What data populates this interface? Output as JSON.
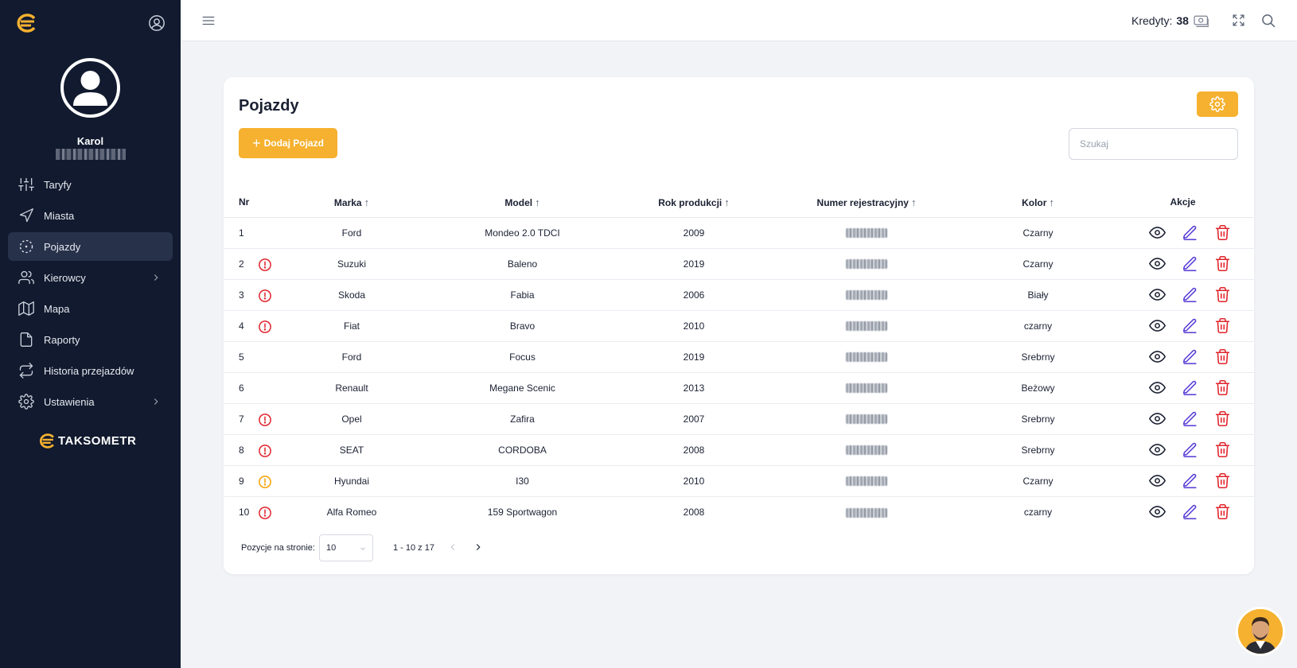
{
  "sidebar": {
    "user_name": "Karol",
    "items": [
      {
        "label": "Taryfy",
        "icon": "sliders-icon"
      },
      {
        "label": "Miasta",
        "icon": "navigation-icon"
      },
      {
        "label": "Pojazdy",
        "icon": "vehicle-target-icon",
        "active": true
      },
      {
        "label": "Kierowcy",
        "icon": "users-icon",
        "has_submenu": true
      },
      {
        "label": "Mapa",
        "icon": "map-icon"
      },
      {
        "label": "Raporty",
        "icon": "file-icon"
      },
      {
        "label": "Historia przejazdów",
        "icon": "repeat-icon"
      },
      {
        "label": "Ustawienia",
        "icon": "gear-icon",
        "has_submenu": true
      }
    ],
    "brand": "TAKSOMETR"
  },
  "topbar": {
    "credits_label": "Kredyty:",
    "credits_value": "38"
  },
  "page": {
    "title": "Pojazdy",
    "add_button_label": "Dodaj Pojazd",
    "search_placeholder": "Szukaj"
  },
  "table": {
    "headers": {
      "nr": "Nr",
      "marka": "Marka",
      "model": "Model",
      "rok": "Rok produkcji",
      "numer": "Numer rejestracyjny",
      "kolor": "Kolor",
      "akcje": "Akcje"
    },
    "rows": [
      {
        "nr": "1",
        "alert": "none",
        "marka": "Ford",
        "model": "Mondeo 2.0 TDCI",
        "rok": "2009",
        "kolor": "Czarny"
      },
      {
        "nr": "2",
        "alert": "red",
        "marka": "Suzuki",
        "model": "Baleno",
        "rok": "2019",
        "kolor": "Czarny"
      },
      {
        "nr": "3",
        "alert": "red",
        "marka": "Skoda",
        "model": "Fabia",
        "rok": "2006",
        "kolor": "Biały"
      },
      {
        "nr": "4",
        "alert": "red",
        "marka": "Fiat",
        "model": "Bravo",
        "rok": "2010",
        "kolor": "czarny"
      },
      {
        "nr": "5",
        "alert": "none",
        "marka": "Ford",
        "model": "Focus",
        "rok": "2019",
        "kolor": "Srebrny"
      },
      {
        "nr": "6",
        "alert": "none",
        "marka": "Renault",
        "model": "Megane Scenic",
        "rok": "2013",
        "kolor": "Beżowy"
      },
      {
        "nr": "7",
        "alert": "red",
        "marka": "Opel",
        "model": "Zafira",
        "rok": "2007",
        "kolor": "Srebrny"
      },
      {
        "nr": "8",
        "alert": "red",
        "marka": "SEAT",
        "model": "CORDOBA",
        "rok": "2008",
        "kolor": "Srebrny"
      },
      {
        "nr": "9",
        "alert": "orange",
        "marka": "Hyundai",
        "model": "I30",
        "rok": "2010",
        "kolor": "Czarny"
      },
      {
        "nr": "10",
        "alert": "red",
        "marka": "Alfa Romeo",
        "model": "159 Sportwagon",
        "rok": "2008",
        "kolor": "czarny"
      }
    ]
  },
  "pagination": {
    "per_page_label": "Pozycje na stronie:",
    "per_page_value": "10",
    "range_text": "1 - 10 z 17"
  },
  "colors": {
    "sidebar_bg": "#111a2e",
    "accent": "#f5b12f",
    "alert_red": "#e0242b",
    "alert_orange": "#f5a000",
    "edit_purple": "#5b3fd6",
    "delete_red": "#e0242b"
  }
}
